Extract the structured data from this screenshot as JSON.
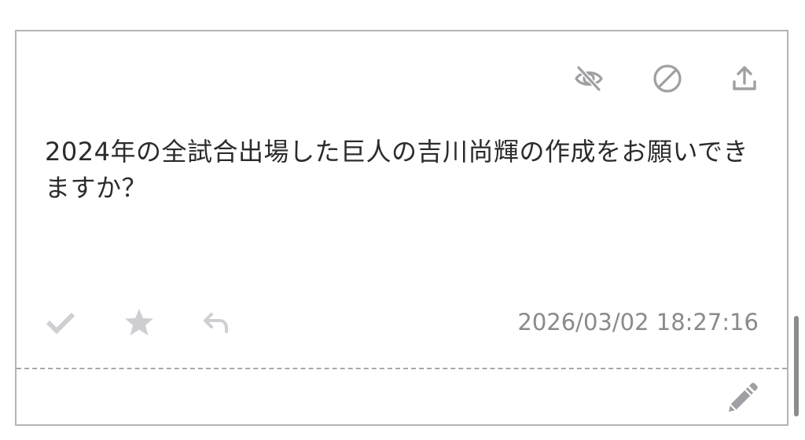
{
  "card": {
    "actions_top": [
      {
        "icon": "eye-off-icon",
        "label": "hide"
      },
      {
        "icon": "block-icon",
        "label": "block"
      },
      {
        "icon": "share-upload-icon",
        "label": "share"
      }
    ],
    "question_text": "2024年の全試合出場した巨人の吉川尚輝の作成をお願いできますか？",
    "actions_bottom": [
      {
        "icon": "check-icon",
        "label": "mark done"
      },
      {
        "icon": "star-icon",
        "label": "favorite"
      },
      {
        "icon": "reply-icon",
        "label": "reply"
      }
    ],
    "timestamp": "2026/03/02 18:27:16",
    "edit_icon": "pencil-icon"
  },
  "colors": {
    "border": "#b4b4b8",
    "icon_top": "#a0a0a4",
    "icon_bottom": "#cfcfd3",
    "text": "#2b2b2b",
    "timestamp": "#8a8a8e"
  }
}
